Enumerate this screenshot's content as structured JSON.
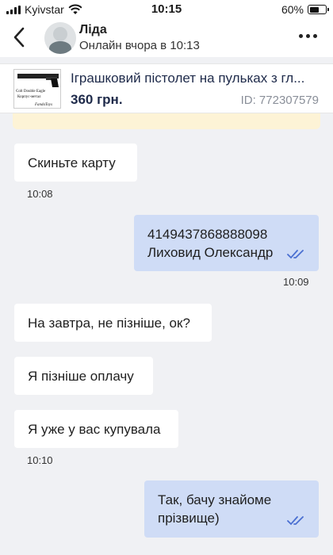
{
  "status_bar": {
    "carrier": "Kyivstar",
    "time": "10:15",
    "battery": "60%",
    "battery_level": 0.6
  },
  "header": {
    "contact_name": "Ліда",
    "contact_status": "Онлайн вчора в 10:13",
    "back_icon": "chevron-left-icon",
    "more_icon": "more-horizontal-icon"
  },
  "product": {
    "title": "Іграшковий пістолет на пульках з гл...",
    "price": "360 грн.",
    "id": "ID: 772307579",
    "thumb_text_1": "Colt Double Eagle",
    "thumb_text_2": "Корпус-метал",
    "thumb_brand": "FandaToys"
  },
  "messages": [
    {
      "direction": "in",
      "text": "Скиньте карту"
    },
    {
      "direction": "out",
      "lines": [
        "4149437868888098",
        "Лиховид Олександр"
      ],
      "read": true
    },
    {
      "direction": "in",
      "text": "На завтра, не пізніше, ок?"
    },
    {
      "direction": "in",
      "text": "Я пізніше оплачу"
    },
    {
      "direction": "in",
      "text": "Я уже у вас купувала"
    },
    {
      "direction": "out",
      "lines": [
        "Так, бачу знайоме",
        "прізвище)"
      ],
      "read": true
    }
  ],
  "times": [
    "10:08",
    "10:09",
    "10:10"
  ],
  "colors": {
    "background": "#f0f1f4",
    "incoming": "#ffffff",
    "outgoing": "#cfdcf6",
    "tick": "#4a6fd1",
    "promo": "#fdf3d6"
  }
}
